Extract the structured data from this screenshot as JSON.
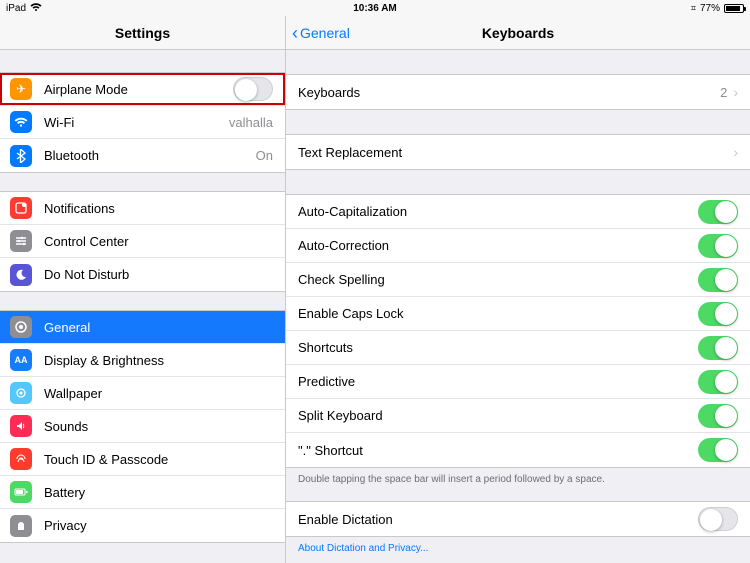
{
  "status": {
    "device": "iPad",
    "time": "10:36 AM",
    "bt": "✱",
    "battery": "77%"
  },
  "sidebar": {
    "title": "Settings",
    "g1": {
      "airplane": "Airplane Mode",
      "wifi": "Wi-Fi",
      "wifi_val": "valhalla",
      "bt": "Bluetooth",
      "bt_val": "On"
    },
    "g2": {
      "notifications": "Notifications",
      "control_center": "Control Center",
      "dnd": "Do Not Disturb"
    },
    "g3": {
      "general": "General",
      "display": "Display & Brightness",
      "wallpaper": "Wallpaper",
      "sounds": "Sounds",
      "touchid": "Touch ID & Passcode",
      "battery": "Battery",
      "privacy": "Privacy"
    }
  },
  "detail": {
    "back": "General",
    "title": "Keyboards",
    "keyboards": {
      "label": "Keyboards",
      "value": "2"
    },
    "text_replacement": "Text Replacement",
    "toggles": {
      "autocap": "Auto-Capitalization",
      "autocorrect": "Auto-Correction",
      "spell": "Check Spelling",
      "capslock": "Enable Caps Lock",
      "shortcuts": "Shortcuts",
      "predictive": "Predictive",
      "splitkb": "Split Keyboard",
      "period": "\".\" Shortcut"
    },
    "hint": "Double tapping the space bar will insert a period followed by a space.",
    "dictation": "Enable Dictation",
    "about_dictation": "About Dictation and Privacy..."
  }
}
